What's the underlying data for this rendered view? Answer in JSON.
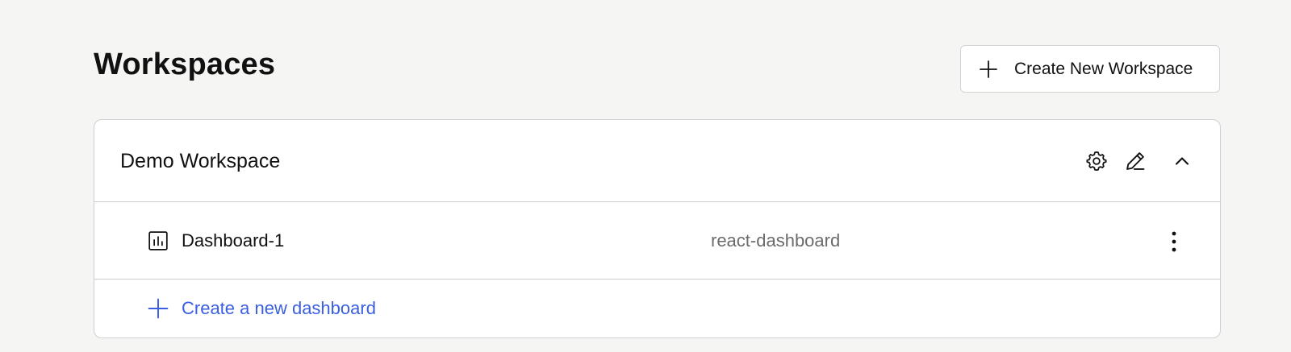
{
  "header": {
    "title": "Workspaces",
    "create_workspace_label": "Create New Workspace"
  },
  "workspace": {
    "name": "Demo Workspace",
    "icons": [
      "gear-icon",
      "pencil-icon",
      "chevron-up-icon"
    ],
    "dashboards": [
      {
        "name": "Dashboard-1",
        "type": "react-dashboard",
        "icon": "bar-chart-icon"
      }
    ],
    "create_dashboard_label": "Create a new dashboard"
  },
  "colors": {
    "background": "#f5f5f4",
    "link": "#3b5fe0",
    "muted_text": "#6b6b6b",
    "border": "#cfcfcf"
  }
}
